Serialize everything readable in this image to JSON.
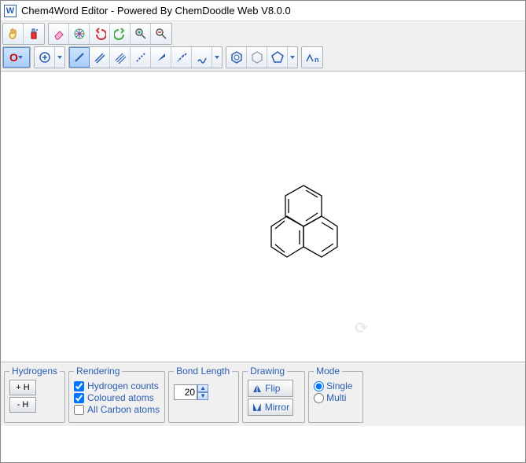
{
  "window": {
    "title": "Chem4Word Editor - Powered By ChemDoodle Web V8.0.0"
  },
  "bottom": {
    "hydrogens": {
      "legend": "Hydrogens",
      "plus": "+ H",
      "minus": "- H"
    },
    "rendering": {
      "legend": "Rendering",
      "hcounts": "Hydrogen counts",
      "coloured": "Coloured atoms",
      "allcarbon": "All Carbon atoms",
      "hcounts_checked": true,
      "coloured_checked": true,
      "allcarbon_checked": false
    },
    "bondlength": {
      "legend": "Bond Length",
      "value": "20"
    },
    "drawing": {
      "legend": "Drawing",
      "flip": "Flip",
      "mirror": "Mirror"
    },
    "mode": {
      "legend": "Mode",
      "single": "Single",
      "multi": "Multi",
      "selected": "single"
    }
  },
  "toolbar_row1": [
    {
      "name": "hand-icon"
    },
    {
      "name": "spray-icon"
    },
    {
      "name": "eraser-icon"
    },
    {
      "name": "compass-icon"
    },
    {
      "name": "undo-icon"
    },
    {
      "name": "redo-icon"
    },
    {
      "name": "zoom-in-icon"
    },
    {
      "name": "zoom-out-icon"
    }
  ],
  "toolbar_row2": {
    "atom_label": "O",
    "bonds": [
      "single",
      "double",
      "triple",
      "dashed",
      "wedge",
      "hash-wedge",
      "wavy"
    ],
    "rings": [
      "benzene",
      "cyclohexane",
      "cyclopentane"
    ],
    "chain_label": "n"
  }
}
